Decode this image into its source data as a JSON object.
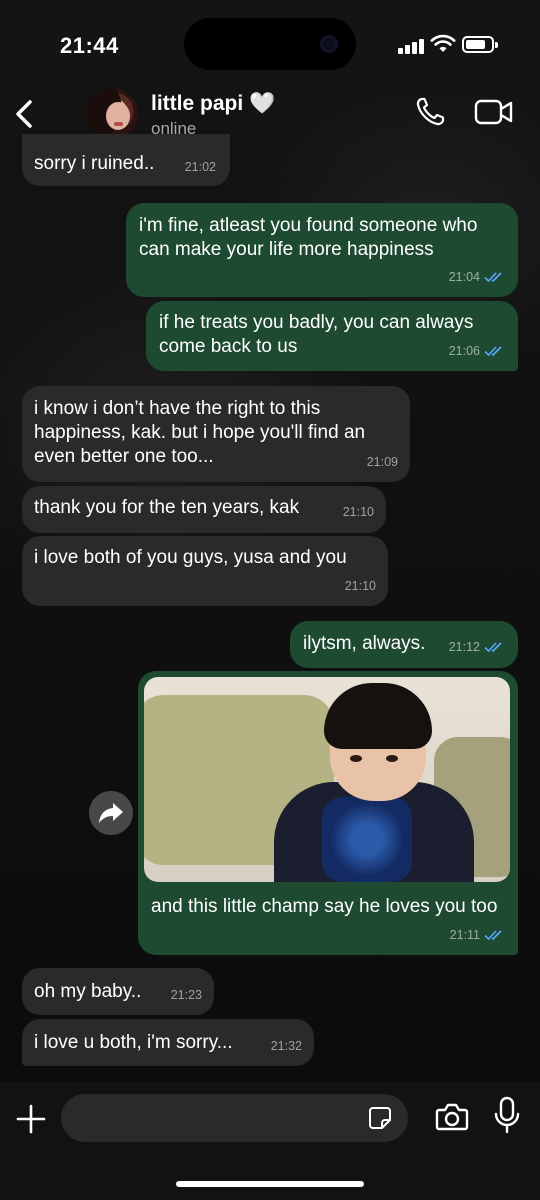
{
  "status_bar": {
    "time": "21:44"
  },
  "header": {
    "contact_name": "little papi 🤍",
    "contact_status": "online"
  },
  "messages": [
    {
      "dir": "in",
      "text": "sorry i ruined..",
      "time": "21:02"
    },
    {
      "dir": "out",
      "text": "i'm fine, atleast you found someone who can make your life more happiness",
      "time": "21:04"
    },
    {
      "dir": "out",
      "text": "if he treats you badly, you can always come back to us",
      "time": "21:06"
    },
    {
      "dir": "in",
      "text": "i know i don’t have the right to this happiness, kak. but i hope you'll find an even better one too...",
      "time": "21:09"
    },
    {
      "dir": "in",
      "text": "thank you for the ten years, kak",
      "time": "21:10"
    },
    {
      "dir": "in",
      "text": "i love both of you guys, yusa and you",
      "time": "21:10"
    },
    {
      "dir": "out",
      "text": "ilytsm, always.",
      "time": "21:12"
    },
    {
      "dir": "out",
      "text": "and this little champ say he loves you too",
      "time": "21:11",
      "has_image": true
    },
    {
      "dir": "in",
      "text": "oh my baby..",
      "time": "21:23"
    },
    {
      "dir": "in",
      "text": "i love u both, i'm sorry...",
      "time": "21:32"
    }
  ],
  "input": {
    "placeholder": ""
  },
  "colors": {
    "incoming_bubble": "#2a2a2a",
    "outgoing_bubble": "#1e4a32",
    "read_ticks": "#5aa7ff"
  },
  "icons": [
    "back-chevron-icon",
    "phone-icon",
    "video-camera-icon",
    "forward-icon",
    "plus-icon",
    "sticker-icon",
    "camera-icon",
    "microphone-icon"
  ]
}
